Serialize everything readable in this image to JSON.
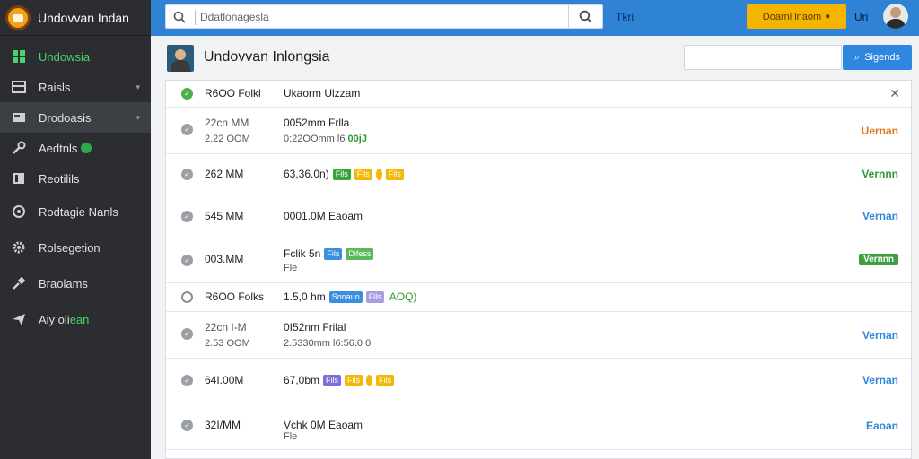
{
  "app": {
    "title": "Undovvan Indan"
  },
  "sidebar": {
    "items": [
      {
        "label": "Undowsia",
        "icon": "grid-icon",
        "active": true
      },
      {
        "label": "Raisls",
        "icon": "list-icon"
      },
      {
        "label": "Drodoasis",
        "icon": "card-icon"
      },
      {
        "label": "Aedtnls",
        "icon": "wrench-icon",
        "badge": true
      },
      {
        "label": "Reotilils",
        "icon": "file-icon"
      },
      {
        "label": "Rodtagie Nanls",
        "icon": "target-icon"
      },
      {
        "label": "Rolsegetion",
        "icon": "gear-icon"
      },
      {
        "label": "Braolams",
        "icon": "pin-icon"
      },
      {
        "label": "Aiy oli",
        "suffix": "ean",
        "icon": "send-icon"
      }
    ]
  },
  "topbar": {
    "search_placeholder": "Ddatlonagesla",
    "link": "Tkri",
    "promo": "Doarnl lnaom",
    "user": "Uri"
  },
  "page": {
    "title": "Undovvan Inlongsia",
    "button": "Sigends"
  },
  "list": {
    "header": {
      "time": "R6OO Folkl",
      "desc": "Ukaorm Ulzzam"
    },
    "rows": [
      {
        "time1": "22cn MM",
        "time2": "2.22 OOM",
        "d1": "0052mm Frlla",
        "d2": "0:22OOmm l6",
        "d2g": "00jJ",
        "action": "Uernan",
        "color": "orange"
      },
      {
        "time1": "262 MM",
        "d1": "63,36.0n)",
        "tags": [
          "Fils",
          "Fils",
          "Fils"
        ],
        "action": "Vernnn",
        "color": "green"
      },
      {
        "time1": "545 MM",
        "d1": "0001.0M Eaoam",
        "action": "Vernan",
        "color": "blue"
      },
      {
        "time1": "003.MM",
        "d1": "Fclik 5n",
        "d2": "Fle",
        "tags": [
          "Fils",
          "Difess"
        ],
        "action": "Vernnn",
        "color": "pill"
      },
      {
        "time1": "R6OO Folks",
        "d1": "1.5,0 hm",
        "tags": [
          "Snnaun",
          "Fils"
        ],
        "extra": "AOQ)"
      },
      {
        "time1": "22cn I-M",
        "time2": "2.53 OOM",
        "d1": "0I52nm Frilal",
        "d2": "2.5330mm l6:56.0 0",
        "action": "Vernan",
        "color": "blue"
      },
      {
        "time1": "64I.00M",
        "d1": "67,0bm",
        "tags": [
          "Fils",
          "Fils",
          "Fils"
        ],
        "action": "Vernan",
        "color": "blue"
      },
      {
        "time1": "32I/MM",
        "d1": "Vchk 0M Eaoam",
        "d2": "Fle",
        "action": "Eaoan",
        "color": "blue"
      }
    ]
  },
  "colors": {
    "accent": "#2e86de",
    "sidebar": "#2b2d30",
    "active": "#48d46a",
    "promo": "#f4b400"
  }
}
